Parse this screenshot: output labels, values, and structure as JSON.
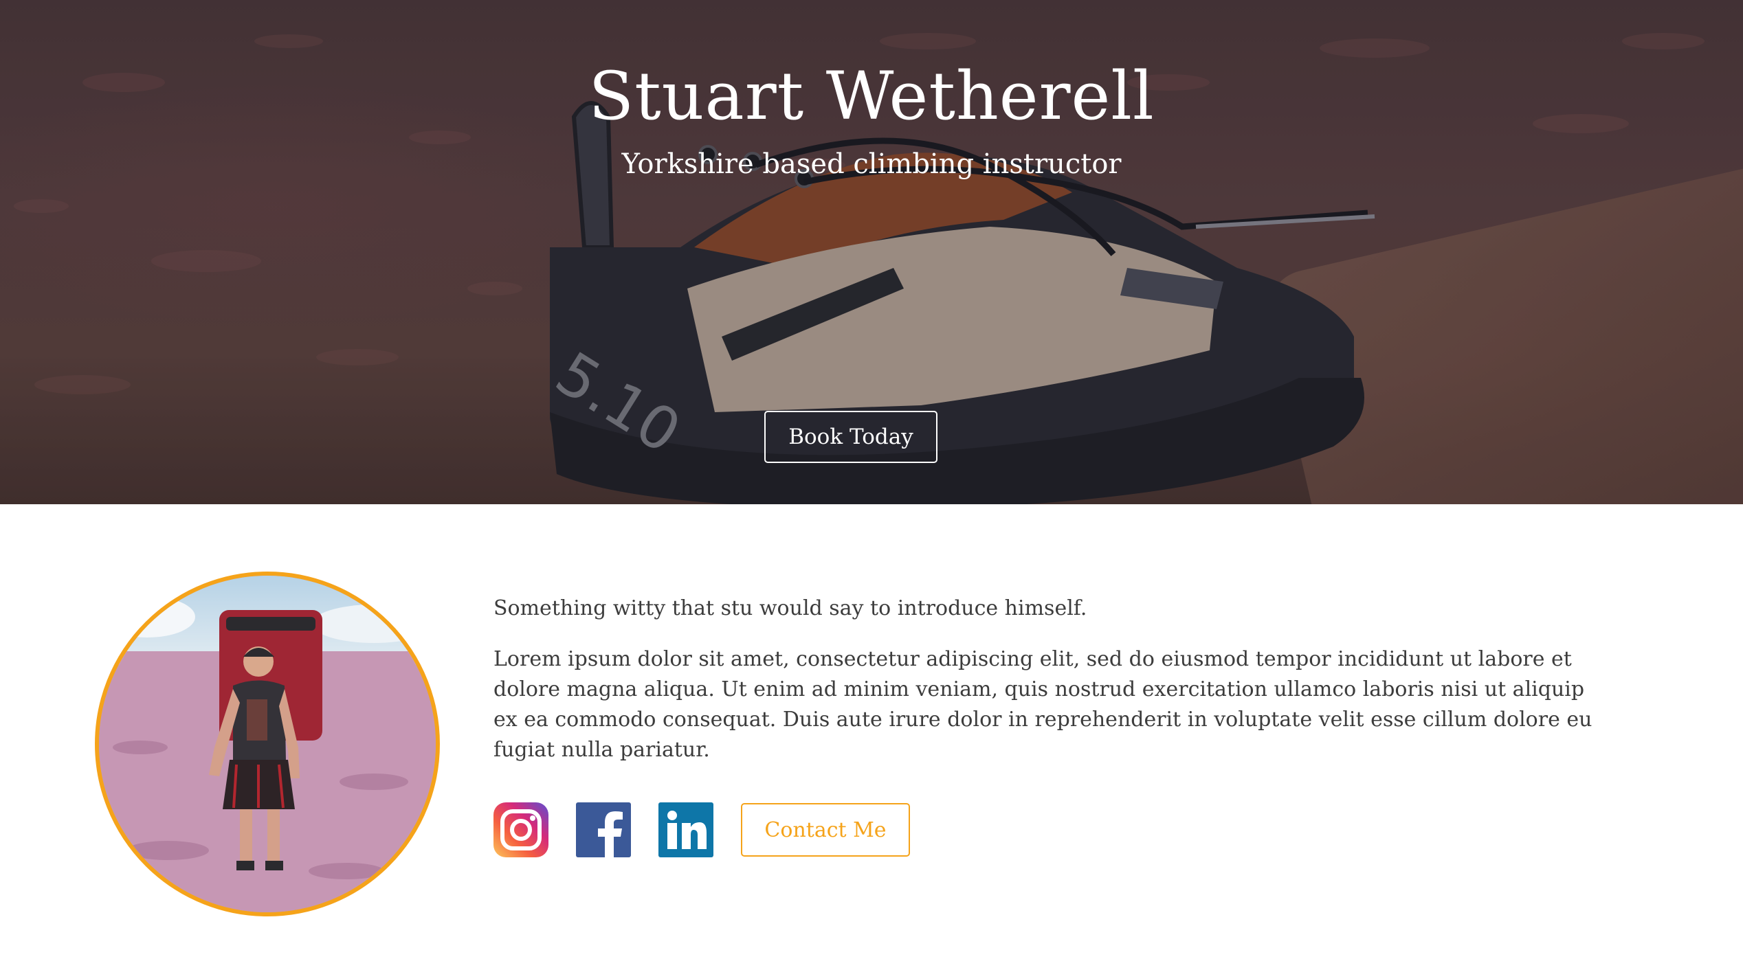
{
  "hero": {
    "title": "Stuart Wetherell",
    "subtitle": "Yorkshire based climbing instructor",
    "book_button_label": "Book Today",
    "background_image": "climbing-shoe-on-rock"
  },
  "about": {
    "photo": "climber-with-crash-pad-portrait",
    "intro": "Something witty that stu would say to introduce himself.",
    "body": "Lorem ipsum dolor sit amet, consectetur adipiscing elit, sed do eiusmod tempor incididunt ut labore et dolore magna aliqua. Ut enim ad minim veniam, quis nostrud exercitation ullamco laboris nisi ut aliquip ex ea commodo consequat. Duis aute irure dolor in reprehenderit in voluptate velit esse cillum dolore eu fugiat nulla pariatur.",
    "social": [
      {
        "icon": "instagram-icon"
      },
      {
        "icon": "facebook-icon"
      },
      {
        "icon": "linkedin-icon"
      }
    ],
    "contact_button_label": "Contact Me"
  },
  "colors": {
    "accent": "#f5a31a",
    "facebook": "#3b5998",
    "linkedin": "#0e76a8",
    "text": "#3c3c3c"
  }
}
